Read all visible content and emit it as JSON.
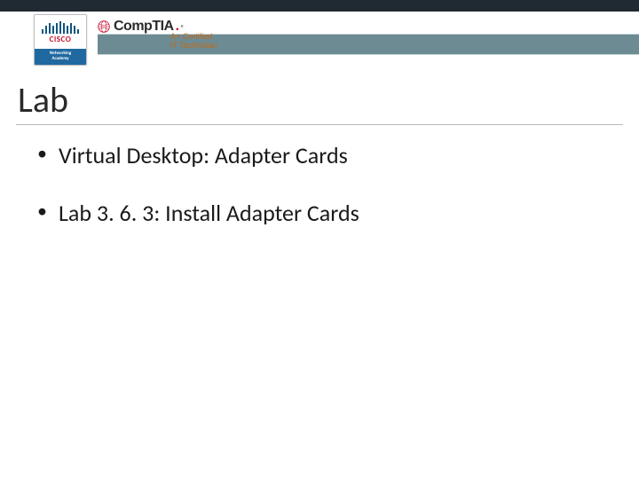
{
  "header": {
    "cisco": {
      "brand": "CISCO",
      "program_line1": "Networking",
      "program_line2": "Academy"
    },
    "comptia": {
      "brand": "CompTIA",
      "dot": ".",
      "reg": "®",
      "cert_line1": "A+ Certified",
      "cert_line2": "IT Technician"
    }
  },
  "slide": {
    "title": "Lab",
    "bullets": [
      "Virtual Desktop: Adapter Cards",
      "Lab 3. 6. 3: Install Adapter Cards"
    ]
  }
}
